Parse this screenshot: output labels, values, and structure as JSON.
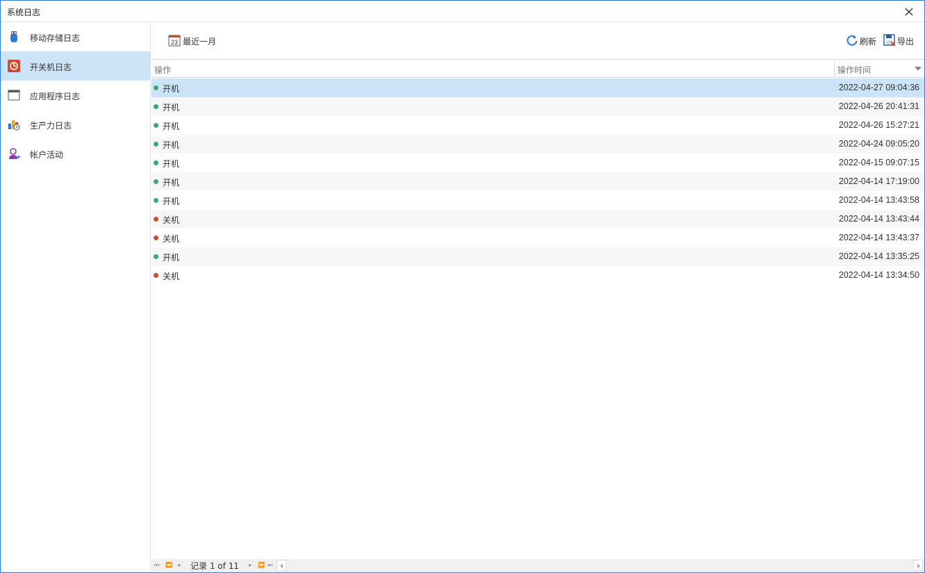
{
  "window": {
    "title": "系统日志"
  },
  "sidebar": {
    "items": [
      {
        "label": "移动存储日志",
        "icon": "usb-drive-icon",
        "active": false
      },
      {
        "label": "开关机日志",
        "icon": "power-log-icon",
        "active": true
      },
      {
        "label": "应用程序日志",
        "icon": "app-window-icon",
        "active": false
      },
      {
        "label": "生产力日志",
        "icon": "productivity-chart-icon",
        "active": false
      },
      {
        "label": "帐户活动",
        "icon": "user-account-icon",
        "active": false
      }
    ]
  },
  "toolbar": {
    "date_filter": {
      "label": "最近一月",
      "icon": "calendar-icon",
      "icon_text": "23"
    },
    "refresh_label": "刷新",
    "export_label": "导出"
  },
  "grid": {
    "columns": [
      "操作",
      "操作时间"
    ],
    "rows": [
      {
        "op": "开机",
        "status": "on",
        "time": "2022-04-27 09:04:36"
      },
      {
        "op": "开机",
        "status": "on",
        "time": "2022-04-26 20:41:31"
      },
      {
        "op": "开机",
        "status": "on",
        "time": "2022-04-26 15:27:21"
      },
      {
        "op": "开机",
        "status": "on",
        "time": "2022-04-24 09:05:20"
      },
      {
        "op": "开机",
        "status": "on",
        "time": "2022-04-15 09:07:15"
      },
      {
        "op": "开机",
        "status": "on",
        "time": "2022-04-14 17:19:00"
      },
      {
        "op": "开机",
        "status": "on",
        "time": "2022-04-14 13:43:58"
      },
      {
        "op": "关机",
        "status": "off",
        "time": "2022-04-14 13:43:44"
      },
      {
        "op": "关机",
        "status": "off",
        "time": "2022-04-14 13:43:37"
      },
      {
        "op": "开机",
        "status": "on",
        "time": "2022-04-14 13:35:25"
      },
      {
        "op": "关机",
        "status": "off",
        "time": "2022-04-14 13:34:50"
      }
    ],
    "selected_row": 0
  },
  "pager": {
    "text": "记录 1 of 11"
  },
  "colors": {
    "accent": "#2b7bd6",
    "selected": "#cce4f7",
    "on": "#3aa57e",
    "off": "#d04a2e"
  }
}
